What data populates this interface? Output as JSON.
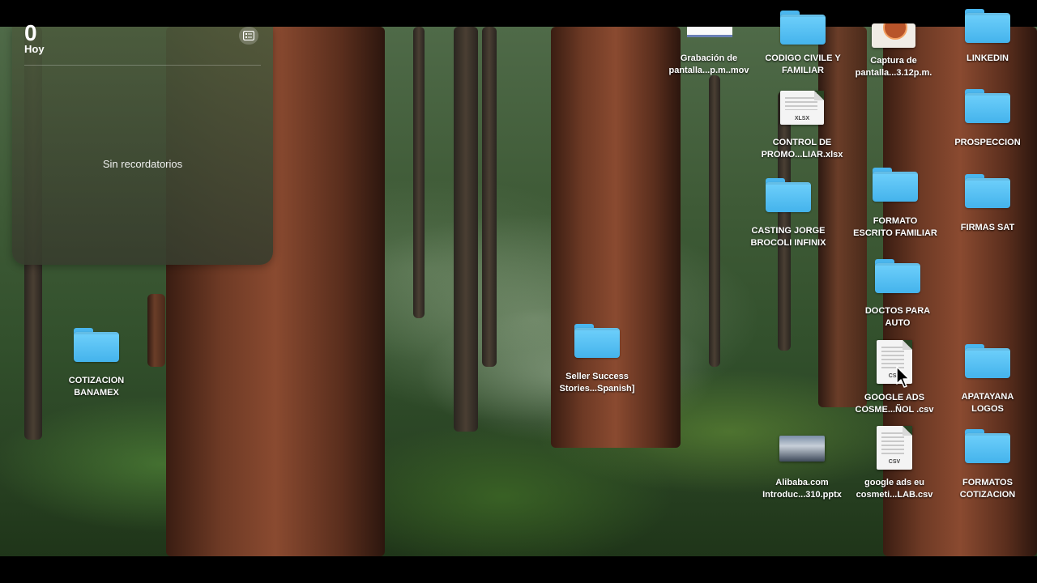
{
  "widget": {
    "count": "0",
    "heading": "Hoy",
    "empty_text": "Sin recordatorios",
    "icon": "list-icon"
  },
  "desktop": {
    "items": [
      {
        "label": "Grabación de\npantalla...p.m..mov",
        "type": "movie"
      },
      {
        "label": "CODIGO CIVILE Y\nFAMILIAR",
        "type": "folder"
      },
      {
        "label": "Captura de\npantalla...3.12p.m.",
        "type": "screenshot"
      },
      {
        "label": "LINKEDIN",
        "type": "folder"
      },
      {
        "label": "CONTROL DE\nPROMO...LIAR.xlsx",
        "type": "xlsx",
        "badge": "XLSX"
      },
      {
        "label": "PROSPECCION",
        "type": "folder"
      },
      {
        "label": "CASTING JORGE\nBROCOLI INFINIX",
        "type": "folder"
      },
      {
        "label": "FORMATO\nESCRITO FAMILIAR",
        "type": "folder"
      },
      {
        "label": "FIRMAS SAT",
        "type": "folder"
      },
      {
        "label": "DOCTOS PARA\nAUTO",
        "type": "folder"
      },
      {
        "label": "COTIZACION\nBANAMEX",
        "type": "folder"
      },
      {
        "label": "Seller Success\nStories...Spanish]",
        "type": "folder"
      },
      {
        "label": "GOOGLE ADS\nCOSME...ÑOL .csv",
        "type": "csv",
        "badge": "CSV"
      },
      {
        "label": "APATAYANA\nLOGOS",
        "type": "folder"
      },
      {
        "label": "Alibaba.com\nIntroduc...310.pptx",
        "type": "pptx"
      },
      {
        "label": "google ads eu\ncosmeti...LAB.csv",
        "type": "csv",
        "badge": "CSV"
      },
      {
        "label": "FORMATOS\nCOTIZACION",
        "type": "folder"
      }
    ]
  },
  "colors": {
    "folder": "#44b3ec",
    "forest": "#3e5a36"
  }
}
